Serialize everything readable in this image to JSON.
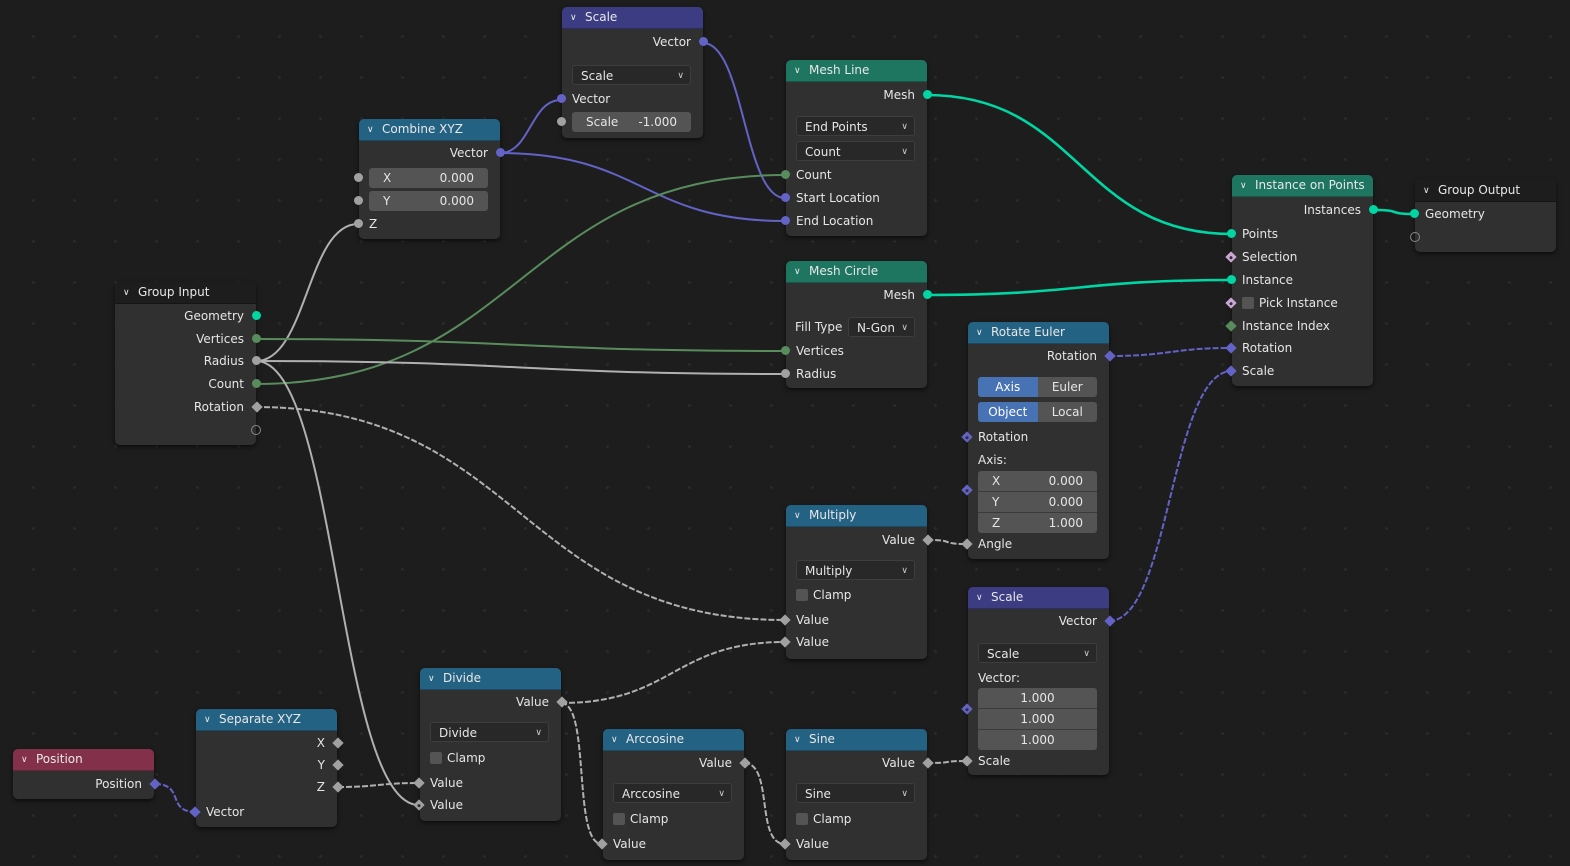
{
  "colors": {
    "geometry": "#00d6a3",
    "integer": "#598c5c",
    "float": "#a1a1a1",
    "vector": "#6363c7",
    "boolean": "#cca6d6",
    "header_geometry": "#1e7560",
    "header_converter": "#246283",
    "header_vector": "#3c3c83",
    "header_input": "#83314a",
    "selected_toggle": "#4772b3"
  },
  "nodes": {
    "scale_top": {
      "title": "Scale",
      "out_vector": "Vector",
      "mode": "Scale",
      "in_vector": "Vector",
      "scale_label": "Scale",
      "scale_value": "-1.000"
    },
    "combine_xyz": {
      "title": "Combine XYZ",
      "out_vector": "Vector",
      "x_label": "X",
      "x_value": "0.000",
      "y_label": "Y",
      "y_value": "0.000",
      "z_label": "Z"
    },
    "mesh_line": {
      "title": "Mesh Line",
      "out_mesh": "Mesh",
      "mode": "End Points",
      "count_mode": "Count",
      "in_count": "Count",
      "in_start": "Start Location",
      "in_end": "End Location"
    },
    "mesh_circle": {
      "title": "Mesh Circle",
      "out_mesh": "Mesh",
      "fill_label": "Fill Type",
      "fill_value": "N-Gon",
      "in_vertices": "Vertices",
      "in_radius": "Radius"
    },
    "group_input": {
      "title": "Group Input",
      "outputs": [
        "Geometry",
        "Vertices",
        "Radius",
        "Count",
        "Rotation"
      ]
    },
    "instance_on_points": {
      "title": "Instance on Points",
      "out_instances": "Instances",
      "inputs": [
        "Points",
        "Selection",
        "Instance",
        "Pick Instance",
        "Instance Index",
        "Rotation",
        "Scale"
      ]
    },
    "group_output": {
      "title": "Group Output",
      "in_geometry": "Geometry"
    },
    "rotate_euler": {
      "title": "Rotate Euler",
      "out_rotation": "Rotation",
      "type_options": [
        "Axis Angle",
        "Euler"
      ],
      "type_selected": "Axis Angle",
      "space_options": [
        "Object",
        "Local"
      ],
      "space_selected": "Object",
      "in_rotation": "Rotation",
      "axis_label": "Axis:",
      "axis": [
        {
          "label": "X",
          "value": "0.000"
        },
        {
          "label": "Y",
          "value": "0.000"
        },
        {
          "label": "Z",
          "value": "1.000"
        }
      ],
      "in_angle": "Angle"
    },
    "multiply": {
      "title": "Multiply",
      "out_value": "Value",
      "operation": "Multiply",
      "clamp_label": "Clamp",
      "clamp": false,
      "in_value_1": "Value",
      "in_value_2": "Value"
    },
    "scale_bottom": {
      "title": "Scale",
      "out_vector": "Vector",
      "mode": "Scale",
      "vector_label": "Vector:",
      "vector": [
        "1.000",
        "1.000",
        "1.000"
      ],
      "in_scale": "Scale"
    },
    "position": {
      "title": "Position",
      "out_position": "Position"
    },
    "separate_xyz": {
      "title": "Separate XYZ",
      "out_x": "X",
      "out_y": "Y",
      "out_z": "Z",
      "in_vector": "Vector"
    },
    "divide": {
      "title": "Divide",
      "out_value": "Value",
      "operation": "Divide",
      "clamp_label": "Clamp",
      "clamp": false,
      "in_value_1": "Value",
      "in_value_2": "Value"
    },
    "arccosine": {
      "title": "Arccosine",
      "out_value": "Value",
      "operation": "Arccosine",
      "clamp_label": "Clamp",
      "clamp": false,
      "in_value": "Value"
    },
    "sine": {
      "title": "Sine",
      "out_value": "Value",
      "operation": "Sine",
      "clamp_label": "Clamp",
      "clamp": false,
      "in_value": "Value"
    }
  },
  "links": [
    {
      "from": "scale_top.Vector",
      "to": "mesh_line.Start Location",
      "type": "vector"
    },
    {
      "from": "combine_xyz.Vector",
      "to": "scale_top.Vector",
      "type": "vector"
    },
    {
      "from": "combine_xyz.Vector",
      "to": "mesh_line.End Location",
      "type": "vector"
    },
    {
      "from": "group_input.Radius",
      "to": "combine_xyz.Z",
      "type": "float"
    },
    {
      "from": "group_input.Count",
      "to": "mesh_line.Count",
      "type": "integer"
    },
    {
      "from": "group_input.Vertices",
      "to": "mesh_circle.Vertices",
      "type": "integer"
    },
    {
      "from": "group_input.Radius",
      "to": "mesh_circle.Radius",
      "type": "float"
    },
    {
      "from": "group_input.Radius",
      "to": "divide.Value",
      "type": "float"
    },
    {
      "from": "group_input.Rotation",
      "to": "multiply.Value",
      "type": "field"
    },
    {
      "from": "mesh_line.Mesh",
      "to": "instance_on_points.Points",
      "type": "geometry"
    },
    {
      "from": "mesh_circle.Mesh",
      "to": "instance_on_points.Instance",
      "type": "geometry"
    },
    {
      "from": "instance_on_points.Instances",
      "to": "group_output.Geometry",
      "type": "geometry"
    },
    {
      "from": "rotate_euler.Rotation",
      "to": "instance_on_points.Rotation",
      "type": "vector-field"
    },
    {
      "from": "scale_bottom.Vector",
      "to": "instance_on_points.Scale",
      "type": "vector-field"
    },
    {
      "from": "multiply.Value",
      "to": "rotate_euler.Angle",
      "type": "field"
    },
    {
      "from": "divide.Value",
      "to": "multiply.Value",
      "type": "field"
    },
    {
      "from": "divide.Value",
      "to": "arccosine.Value",
      "type": "field"
    },
    {
      "from": "arccosine.Value",
      "to": "sine.Value",
      "type": "field"
    },
    {
      "from": "sine.Value",
      "to": "scale_bottom.Scale",
      "type": "field"
    },
    {
      "from": "position.Position",
      "to": "separate_xyz.Vector",
      "type": "vector-field"
    },
    {
      "from": "separate_xyz.Z",
      "to": "divide.Value",
      "type": "field"
    }
  ]
}
